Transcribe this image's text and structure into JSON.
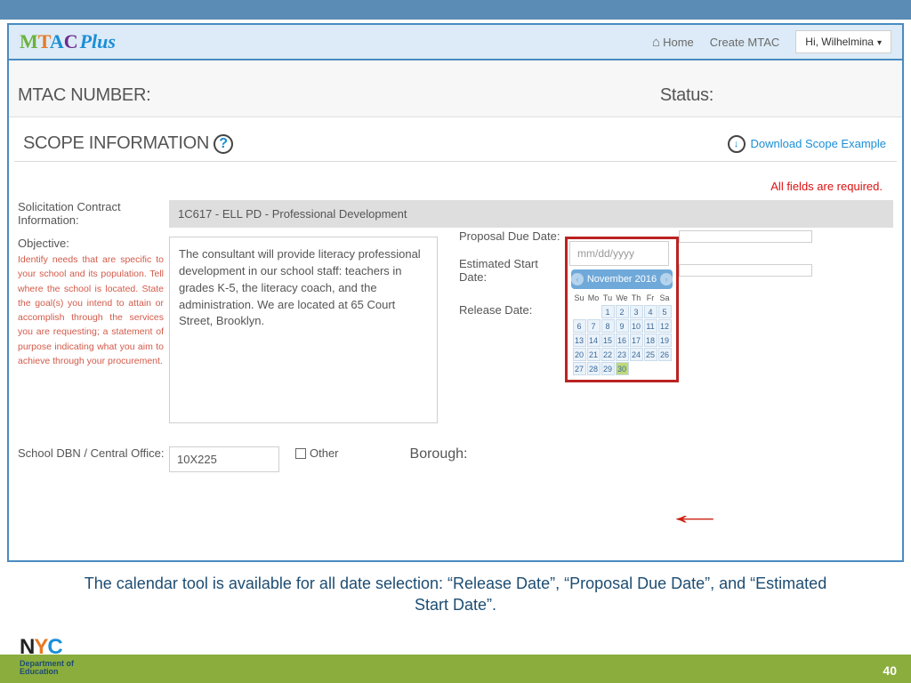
{
  "header": {
    "brand": {
      "m": "M",
      "t": "T",
      "a": "A",
      "c": "C",
      "plus": "Plus"
    },
    "nav": {
      "home": "Home",
      "create": "Create MTAC"
    },
    "user": "Hi, Wilhelmina"
  },
  "bar": {
    "mtac": "MTAC NUMBER:",
    "status": "Status:"
  },
  "scope": {
    "title": "SCOPE INFORMATION",
    "download": "Download Scope Example",
    "required": "All fields are required."
  },
  "form": {
    "solicitation": {
      "label": "Solicitation Contract Information:",
      "value": "1C617 - ELL PD - Professional Development"
    },
    "objective": {
      "label": "Objective:",
      "help": "Identify needs that are specific to your school and its population. Tell where the school is located. State the goal(s) you intend to attain or accomplish through the services you are requesting; a statement of purpose indicating what you aim to achieve through your procurement.",
      "value": "The consultant will provide literacy professional development in our school staff: teachers in grades K-5, the literacy coach, and the administration. We are located at 65 Court Street, Brooklyn."
    },
    "release": {
      "label": "Release Date:",
      "placeholder": "mm/dd/yyyy"
    },
    "proposal": {
      "label": "Proposal Due Date:"
    },
    "start": {
      "label": "Estimated Start Date:"
    },
    "dbn": {
      "label": "School DBN / Central Office:",
      "value": "10X225",
      "other": "Other"
    },
    "borough": {
      "label": "Borough:"
    }
  },
  "calendar": {
    "title": "November 2016",
    "dow": [
      "Su",
      "Mo",
      "Tu",
      "We",
      "Th",
      "Fr",
      "Sa"
    ],
    "weeks": [
      [
        "",
        "",
        "1",
        "2",
        "3",
        "4",
        "5"
      ],
      [
        "6",
        "7",
        "8",
        "9",
        "10",
        "11",
        "12"
      ],
      [
        "13",
        "14",
        "15",
        "16",
        "17",
        "18",
        "19"
      ],
      [
        "20",
        "21",
        "22",
        "23",
        "24",
        "25",
        "26"
      ],
      [
        "27",
        "28",
        "29",
        "30",
        "",
        "",
        ""
      ]
    ],
    "today": "30"
  },
  "caption": "The calendar tool is available for all date selection:  “Release Date”, “Proposal Due Date”, and “Estimated Start Date”.",
  "footer": {
    "nyc": {
      "n": "N",
      "y": "Y",
      "c": "C"
    },
    "dept": "Department of",
    "edu": "Education",
    "page": "40"
  }
}
